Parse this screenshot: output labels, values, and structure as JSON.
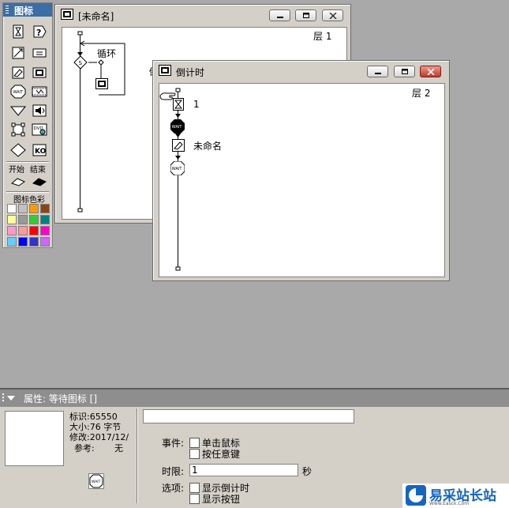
{
  "palette": {
    "title": "图标",
    "tools": [
      "display-icon",
      "interaction-question-icon",
      "motion-icon",
      "calculation-icon",
      "erase-icon",
      "navigate-icon",
      "wait-icon",
      "movie-icon",
      "decision-icon",
      "sound-icon",
      "map-icon",
      "dvd-icon",
      "interaction-icon",
      "knowledge-object-icon"
    ],
    "start_label": "开始",
    "end_label": "结束",
    "colors_label": "图标色彩",
    "swatches": [
      "#ffffff",
      "#c0c0c0",
      "#ff9900",
      "#8b4513",
      "#ffff99",
      "#999999",
      "#33cc33",
      "#008080",
      "#ff99cc",
      "#ff9999",
      "#ff0000",
      "#ff00cc",
      "#66ccff",
      "#0000ff",
      "#3333cc",
      "#cc66ff"
    ]
  },
  "win_main": {
    "title": "[未命名]",
    "layer": "层 1",
    "loop_label": "循环",
    "partial_label": "倒"
  },
  "win_countdown": {
    "title": "倒计时",
    "layer": "层 2",
    "items": [
      {
        "icon": "hourglass-icon",
        "label": "1"
      },
      {
        "icon": "wait-icon",
        "label": ""
      },
      {
        "icon": "calculation-icon",
        "label": "未命名"
      },
      {
        "icon": "wait-icon",
        "label": ""
      }
    ]
  },
  "properties": {
    "title": "属性: 等待图标 []",
    "id_line": "标识:65550",
    "size_line": "大小:76 字节",
    "modified_line": "修改:2017/12/",
    "ref_label": "参考:",
    "ref_value": "无",
    "title_field_value": "",
    "events_label": "事件:",
    "click_mouse": "单击鼠标",
    "press_key": "按任意键",
    "time_limit_label": "时限:",
    "time_limit_value": "1",
    "seconds_label": "秒",
    "options_label": "选项:",
    "show_countdown": "显示倒计时",
    "show_button": "显示按钮"
  },
  "brand": {
    "name": "易采站长站",
    "url": "Www.Easck.Com"
  }
}
